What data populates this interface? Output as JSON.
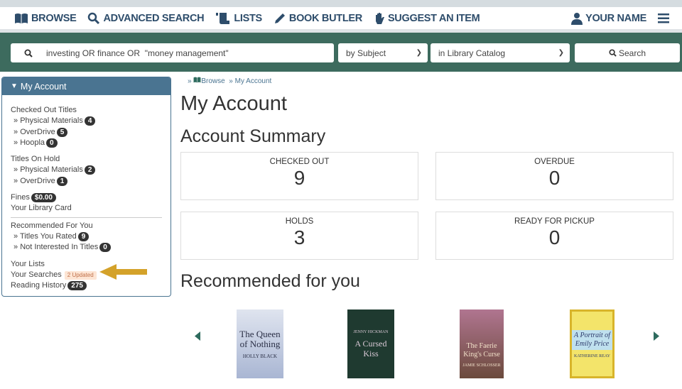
{
  "nav": {
    "items": [
      {
        "label": "BROWSE",
        "icon": "book-open-icon"
      },
      {
        "label": "ADVANCED SEARCH",
        "icon": "search-icon"
      },
      {
        "label": "LISTS",
        "icon": "scroll-icon"
      },
      {
        "label": "BOOK BUTLER",
        "icon": "pencil-icon"
      },
      {
        "label": "SUGGEST AN ITEM",
        "icon": "hand-icon"
      }
    ],
    "user": "YOUR NAME"
  },
  "search": {
    "query": "investing OR finance OR  \"money management\"",
    "type": "by Subject",
    "scope": "in Library Catalog",
    "button": "Search"
  },
  "sidebar": {
    "title": "My Account",
    "checked_out": {
      "label": "Checked Out Titles",
      "items": [
        {
          "label": "Physical Materials",
          "count": "4"
        },
        {
          "label": "OverDrive",
          "count": "5"
        },
        {
          "label": "Hoopla",
          "count": "0"
        }
      ]
    },
    "holds": {
      "label": "Titles On Hold",
      "items": [
        {
          "label": "Physical Materials",
          "count": "2"
        },
        {
          "label": "OverDrive",
          "count": "1"
        }
      ]
    },
    "fines": {
      "label": "Fines",
      "amount": "$0.00"
    },
    "library_card": "Your Library Card",
    "recommended": {
      "label": "Recommended For You",
      "items": [
        {
          "label": "Titles You Rated",
          "count": "9"
        },
        {
          "label": "Not Interested In Titles",
          "count": "0"
        }
      ]
    },
    "lists": "Your Lists",
    "searches": {
      "label": "Your Searches",
      "badge": "2 Updated"
    },
    "history": {
      "label": "Reading History",
      "count": "275"
    }
  },
  "breadcrumb": [
    "Browse",
    "My Account"
  ],
  "page_title": "My Account",
  "summary": {
    "title": "Account Summary",
    "cards": [
      {
        "label": "CHECKED OUT",
        "value": "9"
      },
      {
        "label": "OVERDUE",
        "value": "0"
      },
      {
        "label": "HOLDS",
        "value": "3"
      },
      {
        "label": "READY FOR PICKUP",
        "value": "0"
      }
    ]
  },
  "recommended": {
    "title": "Recommended for you",
    "books": [
      {
        "title": "The Queen of Nothing",
        "author": "Holly Black",
        "color": "#b9c4dc"
      },
      {
        "title": "A Cursed Kiss",
        "author": "Jenny Hickman",
        "color": "#1f3a30"
      },
      {
        "title": "The Faerie King's Curse",
        "author": "Jamie Schlosser",
        "color": "#7a4f5e"
      },
      {
        "title": "A Portrait of Emily Price",
        "author": "Katherine Reay",
        "color": "#f3e46a"
      }
    ]
  },
  "colors": {
    "nav_text": "#2e4d6b",
    "band": "#3d6b5e",
    "sidebar_header": "#4a7491",
    "arrow": "#d4a22a"
  }
}
